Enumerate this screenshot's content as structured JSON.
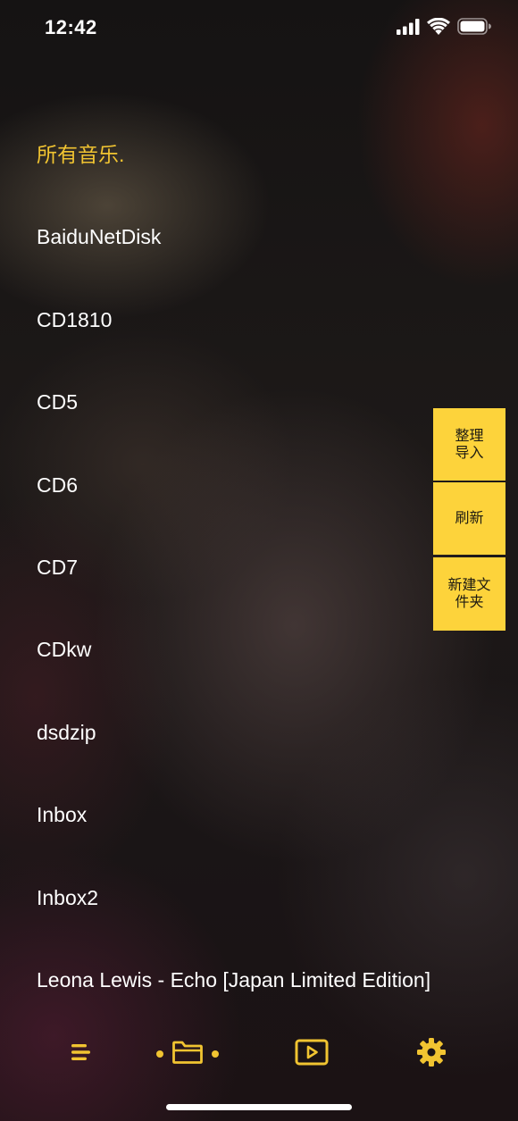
{
  "status_bar": {
    "time": "12:42",
    "icons": [
      "cellular-signal-icon",
      "wifi-icon",
      "battery-icon"
    ]
  },
  "list": {
    "header": "所有音乐.",
    "items": [
      "BaiduNetDisk",
      "CD1810",
      "CD5",
      "CD6",
      "CD7",
      "CDkw",
      "dsdzip",
      "Inbox",
      "Inbox2",
      "Leona Lewis - Echo [Japan Limited Edition]"
    ]
  },
  "side_actions": {
    "organize_import": "整理导入",
    "refresh": "刷新",
    "new_folder": "新建文件夹"
  },
  "tab_bar": {
    "tabs": [
      "list-icon",
      "folder-icon",
      "now-playing-icon",
      "gear-icon"
    ],
    "active": "folder-icon"
  },
  "colors": {
    "accent": "#f1c431",
    "button_bg": "#fdd33b",
    "text": "#ffffff"
  }
}
